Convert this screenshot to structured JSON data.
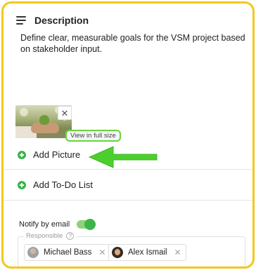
{
  "description": {
    "title": "Description",
    "text": "Define clear, measurable goals for the VSM project based on stakeholder input."
  },
  "picture": {
    "view_full_label": "View in full size",
    "remove_symbol": "✕"
  },
  "actions": {
    "add_picture": "Add Picture",
    "add_todo": "Add To-Do List"
  },
  "notify": {
    "label": "Notify by email",
    "enabled": true
  },
  "responsible": {
    "label": "Responsible",
    "help_symbol": "?",
    "people": [
      {
        "name": "Michael Bass",
        "remove_symbol": "✕"
      },
      {
        "name": "Alex Ismail",
        "remove_symbol": "✕"
      }
    ]
  },
  "colors": {
    "frame_border": "#f2c81e",
    "accent_green": "#3cb44a",
    "highlight_green": "#6ad33a"
  },
  "icons": {
    "description": "lines-icon",
    "add": "plus-circle-icon",
    "help": "help-icon",
    "remove": "close-icon",
    "annotation": "arrow-icon"
  }
}
